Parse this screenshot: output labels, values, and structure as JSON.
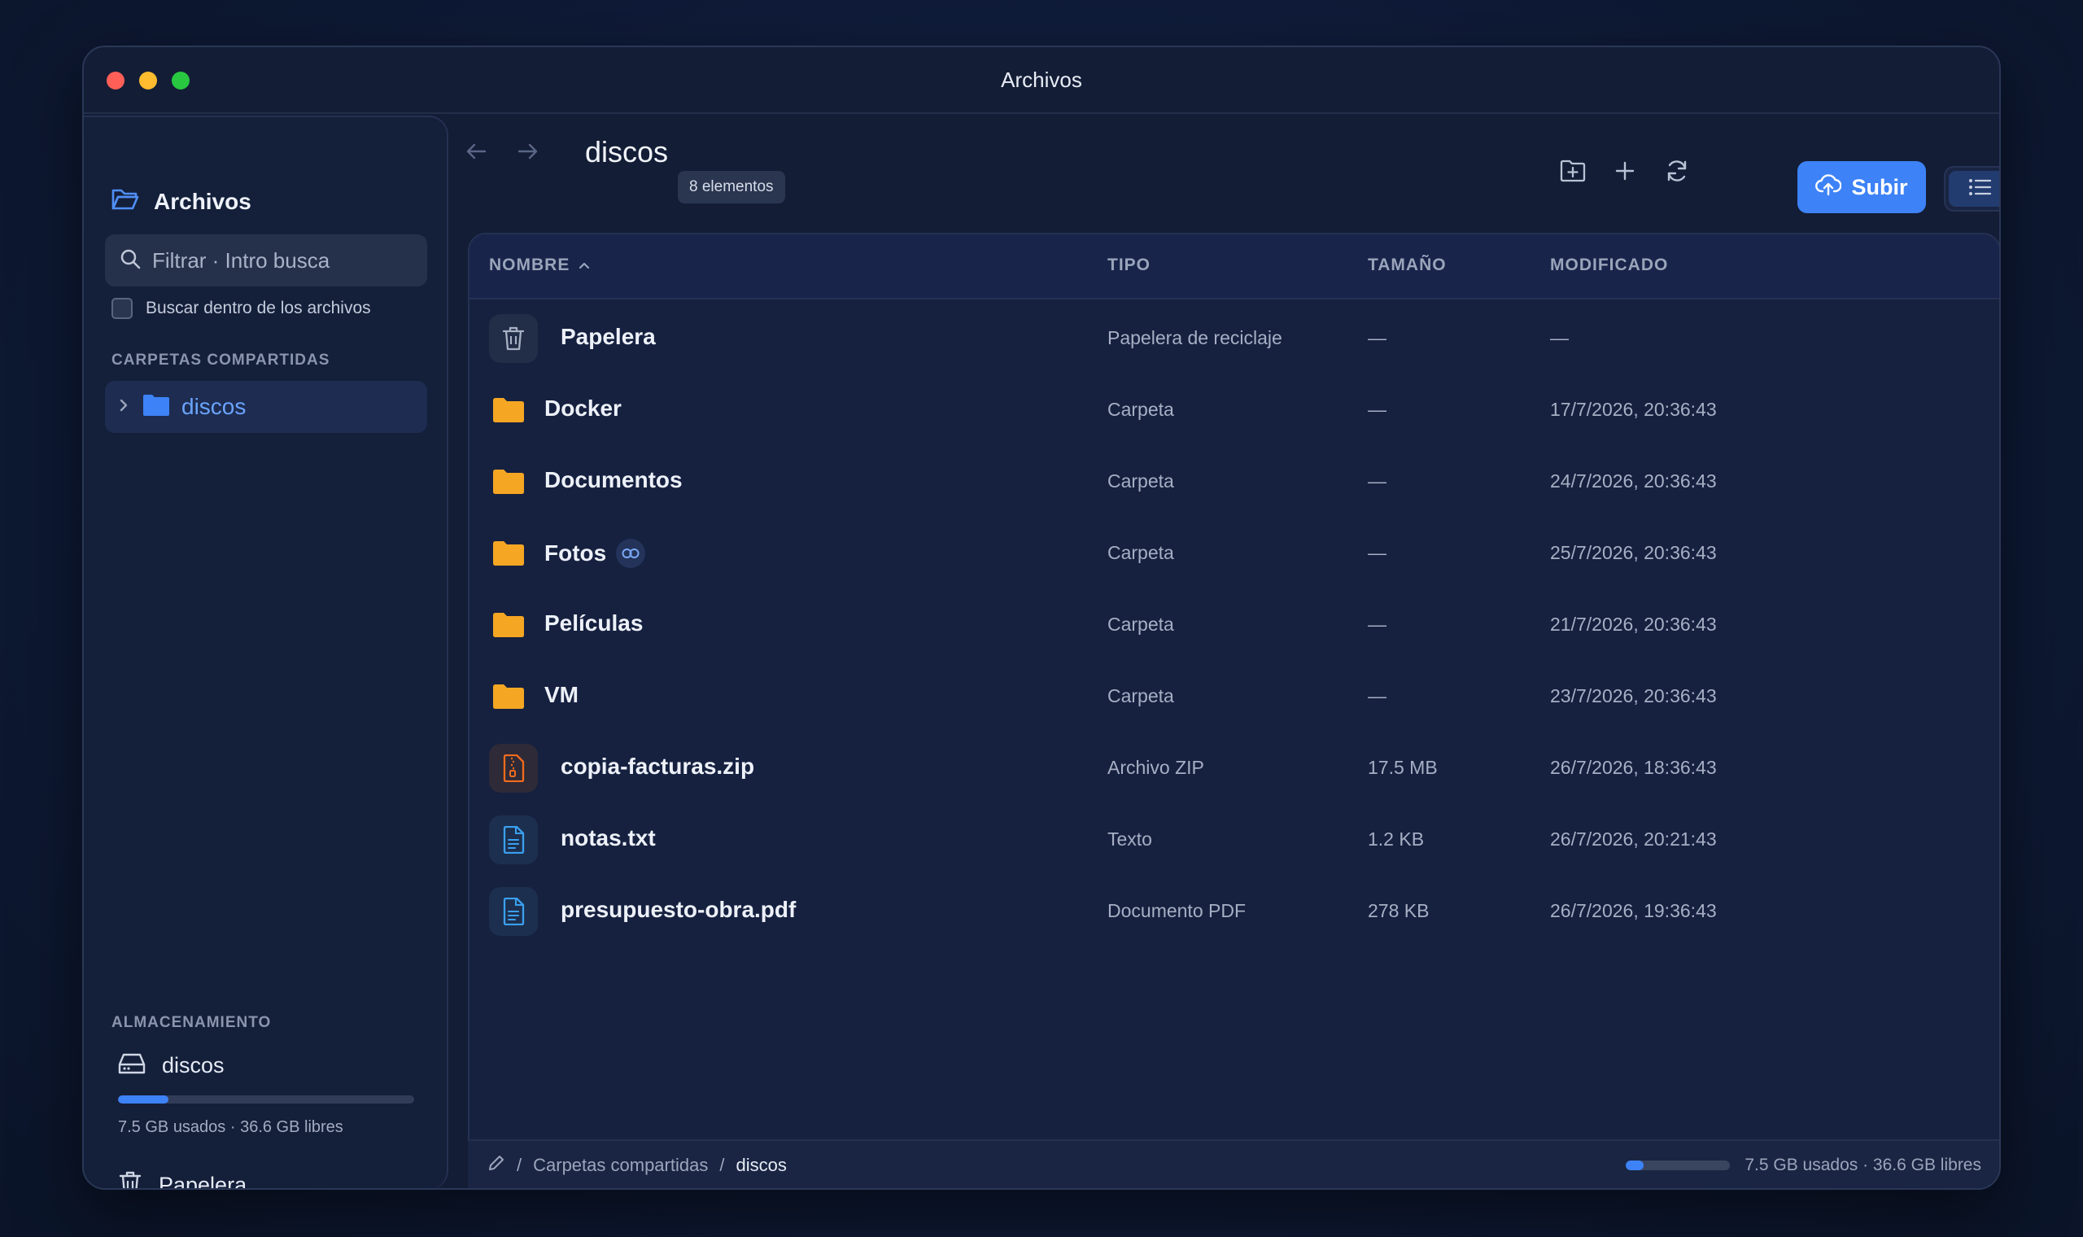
{
  "window": {
    "title": "Archivos"
  },
  "sidebar": {
    "app_label": "Archivos",
    "search": {
      "placeholder": "Filtrar · Intro busca",
      "value": ""
    },
    "search_contents_label": "Buscar dentro de los archivos",
    "shared_section_label": "CARPETAS COMPARTIDAS",
    "shared_items": [
      {
        "label": "discos",
        "icon": "folder-icon",
        "color": "#3d82f6"
      }
    ],
    "storage_section_label": "ALMACENAMIENTO",
    "storage": {
      "label": "discos",
      "used_fraction": 0.17,
      "summary": "7.5 GB usados · 36.6 GB libres"
    },
    "trash_label": "Papelera"
  },
  "toolbar": {
    "folder_title": "discos",
    "count_badge": "8 elementos",
    "upload_label": "Subir",
    "accent": "#3d82f6"
  },
  "table": {
    "columns": {
      "name": "NOMBRE",
      "type": "TIPO",
      "size": "TAMAÑO",
      "modified": "MODIFICADO"
    },
    "rows": [
      {
        "name": "Papelera",
        "type": "Papelera de reciclaje",
        "size": "—",
        "modified": "—",
        "icon": "trash-icon"
      },
      {
        "name": "Docker",
        "type": "Carpeta",
        "size": "—",
        "modified": "17/7/2026, 20:36:43",
        "icon": "folder-icon"
      },
      {
        "name": "Documentos",
        "type": "Carpeta",
        "size": "—",
        "modified": "24/7/2026, 20:36:43",
        "icon": "folder-icon"
      },
      {
        "name": "Fotos",
        "type": "Carpeta",
        "size": "—",
        "modified": "25/7/2026, 20:36:43",
        "icon": "folder-icon",
        "shared_link": true
      },
      {
        "name": "Películas",
        "type": "Carpeta",
        "size": "—",
        "modified": "21/7/2026, 20:36:43",
        "icon": "folder-icon"
      },
      {
        "name": "VM",
        "type": "Carpeta",
        "size": "—",
        "modified": "23/7/2026, 20:36:43",
        "icon": "folder-icon"
      },
      {
        "name": "copia-facturas.zip",
        "type": "Archivo ZIP",
        "size": "17.5 MB",
        "modified": "26/7/2026, 18:36:43",
        "icon": "zip-file-icon"
      },
      {
        "name": "notas.txt",
        "type": "Texto",
        "size": "1.2 KB",
        "modified": "26/7/2026, 20:21:43",
        "icon": "text-file-icon"
      },
      {
        "name": "presupuesto-obra.pdf",
        "type": "Documento PDF",
        "size": "278 KB",
        "modified": "26/7/2026, 19:36:43",
        "icon": "pdf-file-icon"
      }
    ]
  },
  "statusbar": {
    "crumb_root": "Carpetas compartidas",
    "crumb_current": "discos",
    "separator": "/",
    "used_fraction": 0.17,
    "summary": "7.5 GB usados · 36.6 GB libres"
  }
}
